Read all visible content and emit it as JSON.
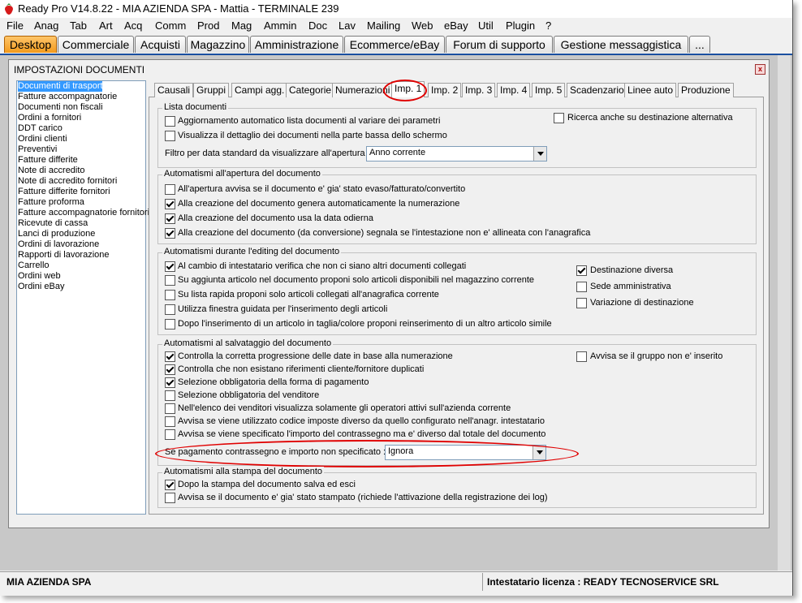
{
  "window": {
    "title": "Ready Pro V14.8.22 - MIA AZIENDA SPA - Mattia - TERMINALE 239",
    "app_icon": "strawberry-icon"
  },
  "menu": [
    "File",
    "Anag",
    "Tab",
    "Art",
    "Acq",
    "Comm",
    "Prod",
    "Mag",
    "Ammin",
    "Doc",
    "Lav",
    "Mailing",
    "Web",
    "eBay",
    "Util",
    "Plugin",
    "?"
  ],
  "tabs": [
    "Desktop",
    "Commerciale",
    "Acquisti",
    "Magazzino",
    "Amministrazione",
    "Ecommerce/eBay",
    "Forum di supporto",
    "Gestione messaggistica",
    "..."
  ],
  "dialog": {
    "title": "IMPOSTAZIONI DOCUMENTI",
    "close_icon": "close-icon",
    "doc_types": [
      "Documenti di trasporto",
      "Fatture accompagnatorie",
      "Documenti non fiscali",
      "Ordini a fornitori",
      "DDT carico",
      "Ordini clienti",
      "Preventivi",
      "Fatture differite",
      "Note di accredito",
      "Note di accredito fornitori",
      "Fatture differite fornitori",
      "Fatture proforma",
      "Fatture accompagnatorie fornitori",
      "Ricevute di cassa",
      "Lanci di produzione",
      "Ordini di lavorazione",
      "Rapporti di lavorazione",
      "Carrello",
      "Ordini web",
      "Ordini eBay"
    ],
    "sub_tabs": [
      "Causali",
      "Gruppi",
      "Campi agg.",
      "Categorie",
      "Numerazioni",
      "Imp. 1",
      "Imp. 2",
      "Imp. 3",
      "Imp. 4",
      "Imp. 5",
      "Scadenzario",
      "Linee auto",
      "Produzione"
    ],
    "lista": {
      "title": "Lista documenti",
      "items": [
        {
          "label": "Aggiornamento automatico lista documenti al variare dei parametri",
          "checked": false
        },
        {
          "label": "Visualizza il dettaglio dei documenti nella parte bassa dello schermo",
          "checked": false
        },
        {
          "label": "Ricerca anche su destinazione alternativa",
          "checked": false
        }
      ],
      "filter_label": "Filtro per data standard da visualizzare all'apertura :",
      "filter_value": "Anno corrente"
    },
    "apertura": {
      "title": "Automatismi all'apertura del documento",
      "items": [
        {
          "label": "All'apertura avvisa se il documento e' gia' stato evaso/fatturato/convertito",
          "checked": false
        },
        {
          "label": "Alla creazione del documento genera automaticamente la numerazione",
          "checked": true
        },
        {
          "label": "Alla creazione del documento usa la data odierna",
          "checked": true
        },
        {
          "label": "Alla creazione del documento (da conversione) segnala se l'intestazione non e' allineata con l'anagrafica",
          "checked": true
        }
      ]
    },
    "editing": {
      "title": "Automatismi durante l'editing del documento",
      "items": [
        {
          "label": "Al cambio di intestatario verifica che non ci siano altri documenti collegati",
          "checked": true
        },
        {
          "label": "Su aggiunta articolo nel documento proponi solo articoli disponibili nel magazzino corrente",
          "checked": false
        },
        {
          "label": "Su lista rapida proponi solo articoli collegati all'anagrafica corrente",
          "checked": false
        },
        {
          "label": "Utilizza finestra guidata per l'inserimento degli articoli",
          "checked": false
        },
        {
          "label": "Dopo l'inserimento di un articolo in taglia/colore proponi reinserimento di un altro articolo simile",
          "checked": false
        }
      ],
      "right_items": [
        {
          "label": "Destinazione diversa",
          "checked": true
        },
        {
          "label": "Sede amministrativa",
          "checked": false
        },
        {
          "label": "Variazione di destinazione",
          "checked": false
        }
      ]
    },
    "salvataggio": {
      "title": "Automatismi al salvataggio del documento",
      "items": [
        {
          "label": "Controlla la corretta progressione delle date in base alla numerazione",
          "checked": true
        },
        {
          "label": "Controlla che non esistano riferimenti cliente/fornitore duplicati",
          "checked": true
        },
        {
          "label": "Selezione obbligatoria della forma di pagamento",
          "checked": true
        },
        {
          "label": "Selezione obbligatoria del venditore",
          "checked": false
        },
        {
          "label": "Nell'elenco dei venditori visualizza solamente gli operatori attivi sull'azienda corrente",
          "checked": false
        },
        {
          "label": "Avvisa se viene utilizzato codice imposte diverso da quello configurato nell'anagr. intestatario",
          "checked": false
        },
        {
          "label": "Avvisa se viene specificato l'importo del contrassegno ma e' diverso dal totale del documento",
          "checked": false
        }
      ],
      "right_item": {
        "label": "Avvisa se il gruppo non e' inserito",
        "checked": false
      },
      "combo_label": "Se pagamento contrassegno e importo non specificato :",
      "combo_value": "Ignora"
    },
    "stampa": {
      "title": "Automatismi alla stampa del documento",
      "items": [
        {
          "label": "Dopo la stampa del documento salva ed esci",
          "checked": true
        },
        {
          "label": "Avvisa se il documento e' gia' stato stampato (richiede l'attivazione della registrazione dei log)",
          "checked": false
        }
      ]
    }
  },
  "statusbar": {
    "company": "MIA AZIENDA SPA",
    "license": "Intestatario licenza : READY TECNOSERVICE SRL"
  },
  "colors": {
    "active_tab": "#f39a1c",
    "selection": "#3399ff",
    "highlight_mark": "#e00000"
  }
}
